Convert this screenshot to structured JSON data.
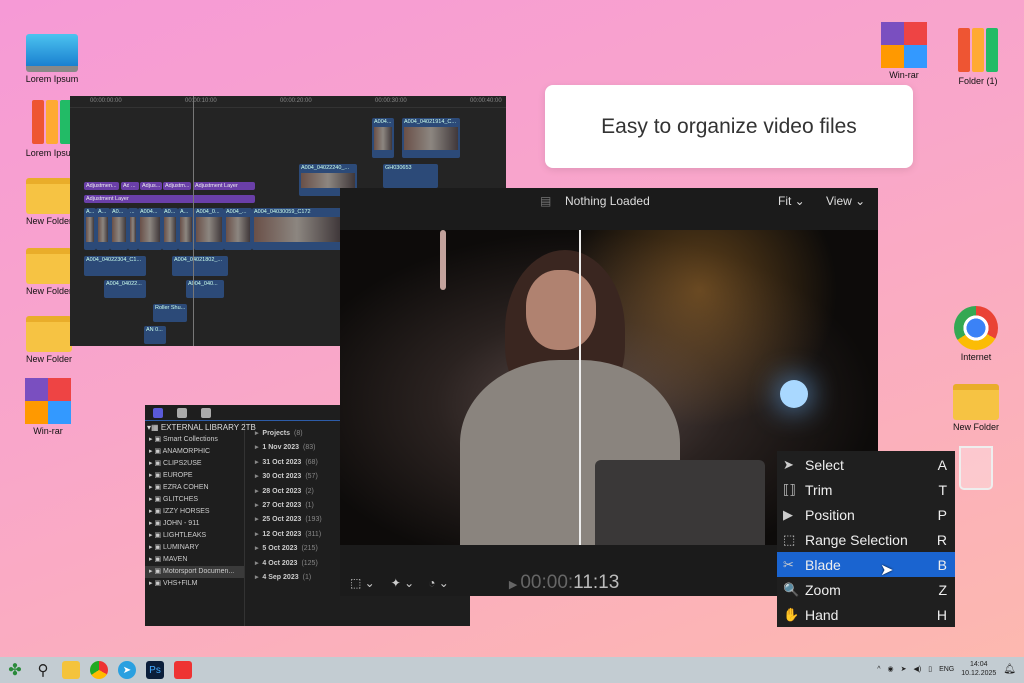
{
  "desktop_left": [
    {
      "label": "Lorem Ipsum",
      "icon": "monitor-icon"
    },
    {
      "label": "Lorem Ipsum",
      "icon": "binders-icon"
    },
    {
      "label": "New Folder",
      "icon": "folder-icon"
    },
    {
      "label": "New Folder",
      "icon": "folder-icon"
    },
    {
      "label": "New Folder",
      "icon": "folder-icon"
    },
    {
      "label": "Win-rar",
      "icon": "winrar-icon"
    }
  ],
  "desktop_right": [
    {
      "label": "Win-rar",
      "icon": "winrar-icon"
    },
    {
      "label": "Folder (1)",
      "icon": "binders-icon"
    },
    {
      "label": "Internet",
      "icon": "chrome-icon"
    },
    {
      "label": "New Folder",
      "icon": "folder-icon"
    },
    {
      "label": "",
      "icon": "trash-icon"
    }
  ],
  "callout": "Easy to organize video files",
  "timeline": {
    "ruler": [
      "00:00:00:00",
      "00:00:10:00",
      "00:00:20:00",
      "00:00:30:00",
      "00:00:40:00"
    ],
    "clips": [
      "A004...",
      "A004_04021914_C...",
      "A004_04022240_...",
      "GH030653",
      "Adjustmen...",
      "Adj...",
      "...",
      "Adjus...",
      "Adjustm...",
      "Adjustment Layer",
      "Adjustment Layer",
      "A...",
      "A...",
      "A0...",
      "...",
      "A004...",
      "A0...",
      "A...",
      "A004_0...",
      "A004_...",
      "A004_04030059_C172",
      "A004_04022304_C1...",
      "A004_04021802_...",
      "A004_04022...",
      "A004_040...",
      "Roller Shu...",
      "AN 0..."
    ]
  },
  "library": {
    "root": "EXTERNAL LIBRARY 2TB",
    "items": [
      "Smart Collections",
      "ANAMORPHIC",
      "CLIPS2USE",
      "EUROPE",
      "EZRA COHEN",
      "GLITCHES",
      "IZZY HORSES",
      "JOHN - 911",
      "LIGHTLEAKS",
      "LUMINARY",
      "MAVEN",
      "Motorsport Documen...",
      "VHS+FILM"
    ],
    "events": [
      {
        "name": "Projects",
        "count": "(8)"
      },
      {
        "name": "1 Nov 2023",
        "count": "(83)"
      },
      {
        "name": "31 Oct 2023",
        "count": "(68)"
      },
      {
        "name": "30 Oct 2023",
        "count": "(57)"
      },
      {
        "name": "28 Oct 2023",
        "count": "(2)"
      },
      {
        "name": "27 Oct 2023",
        "count": "(1)"
      },
      {
        "name": "25 Oct 2023",
        "count": "(193)"
      },
      {
        "name": "12 Oct 2023",
        "count": "(311)"
      },
      {
        "name": "5 Oct 2023",
        "count": "(215)"
      },
      {
        "name": "4 Oct 2023",
        "count": "(125)"
      },
      {
        "name": "4 Sep 2023",
        "count": "(1)"
      }
    ]
  },
  "viewer": {
    "title": "Nothing Loaded",
    "fit": "Fit",
    "view": "View",
    "timecode_dim": "00:00:",
    "timecode": "11:13"
  },
  "tools": [
    {
      "label": "Select",
      "key": "A",
      "icon": "arrow-icon",
      "g": "➤"
    },
    {
      "label": "Trim",
      "key": "T",
      "icon": "trim-icon",
      "g": "⟦⟧"
    },
    {
      "label": "Position",
      "key": "P",
      "icon": "position-icon",
      "g": "▶"
    },
    {
      "label": "Range Selection",
      "key": "R",
      "icon": "range-icon",
      "g": "⬚"
    },
    {
      "label": "Blade",
      "key": "B",
      "icon": "scissors-icon",
      "g": "✂"
    },
    {
      "label": "Zoom",
      "key": "Z",
      "icon": "magnifier-icon",
      "g": "🔍"
    },
    {
      "label": "Hand",
      "key": "H",
      "icon": "hand-icon",
      "g": "✋"
    }
  ],
  "taskbar": {
    "lang": "ENG",
    "time": "14:04",
    "date": "10.12.2025"
  },
  "colors": {
    "accent": "#1a64d0",
    "adjustment": "#6a3fa8",
    "clip": "#2c4a78"
  }
}
